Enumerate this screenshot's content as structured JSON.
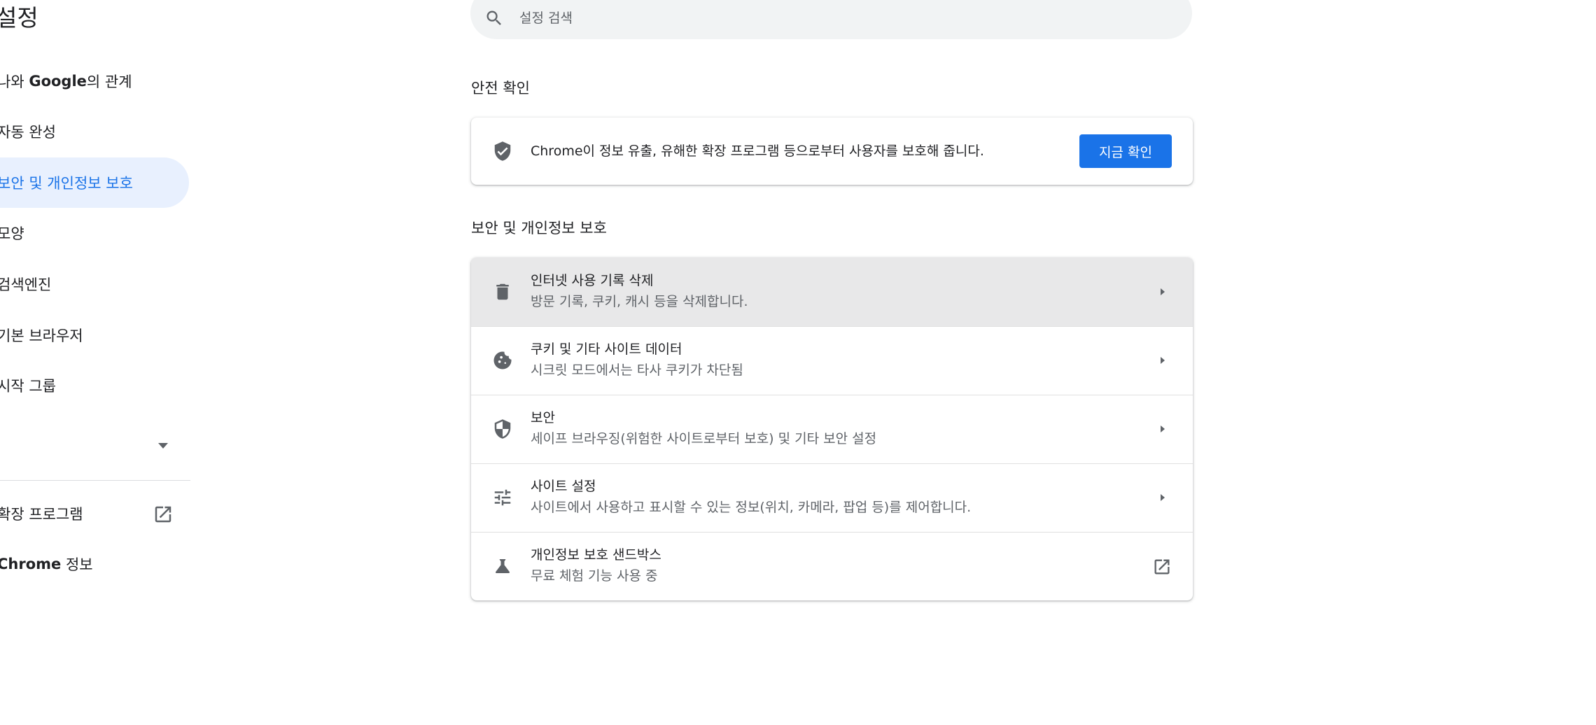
{
  "sidebar": {
    "title": "설정",
    "items": [
      {
        "label_bold": "Google",
        "label_pre": "나와 ",
        "label_post": "의 관계"
      },
      {
        "label": "자동 완성"
      },
      {
        "label": "보안 및 개인정보 보호",
        "active": true
      },
      {
        "label": "모양"
      },
      {
        "label": "검색엔진"
      },
      {
        "label": "기본 브라우저"
      },
      {
        "label": "시작 그룹"
      }
    ],
    "extensions_label": "확장 프로그램",
    "about_label_bold": "Chrome",
    "about_label_post": " 정보"
  },
  "search": {
    "placeholder": "설정 검색"
  },
  "safety_check": {
    "heading": "안전 확인",
    "description": "Chrome이 정보 유출, 유해한 확장 프로그램 등으로부터 사용자를 보호해 줍니다.",
    "button_label": "지금 확인"
  },
  "privacy": {
    "heading": "보안 및 개인정보 보호",
    "rows": [
      {
        "title": "인터넷 사용 기록 삭제",
        "subtitle": "방문 기록, 쿠키, 캐시 등을 삭제합니다.",
        "icon": "trash-icon"
      },
      {
        "title": "쿠키 및 기타 사이트 데이터",
        "subtitle": "시크릿 모드에서는 타사 쿠키가 차단됨",
        "icon": "cookie-icon"
      },
      {
        "title": "보안",
        "subtitle": "세이프 브라우징(위험한 사이트로부터 보호) 및 기타 보안 설정",
        "icon": "security-shield-icon"
      },
      {
        "title": "사이트 설정",
        "subtitle": "사이트에서 사용하고 표시할 수 있는 정보(위치, 카메라, 팝업 등)를 제어합니다.",
        "icon": "tune-icon"
      },
      {
        "title": "개인정보 보호 샌드박스",
        "subtitle": "무료 체험 기능 사용 중",
        "icon": "flask-icon"
      }
    ]
  },
  "colors": {
    "accent": "#1a73e8",
    "active_nav_bg": "#e8f0fe",
    "hover_row_bg": "#e8e8e9",
    "icon": "#5f6368"
  }
}
